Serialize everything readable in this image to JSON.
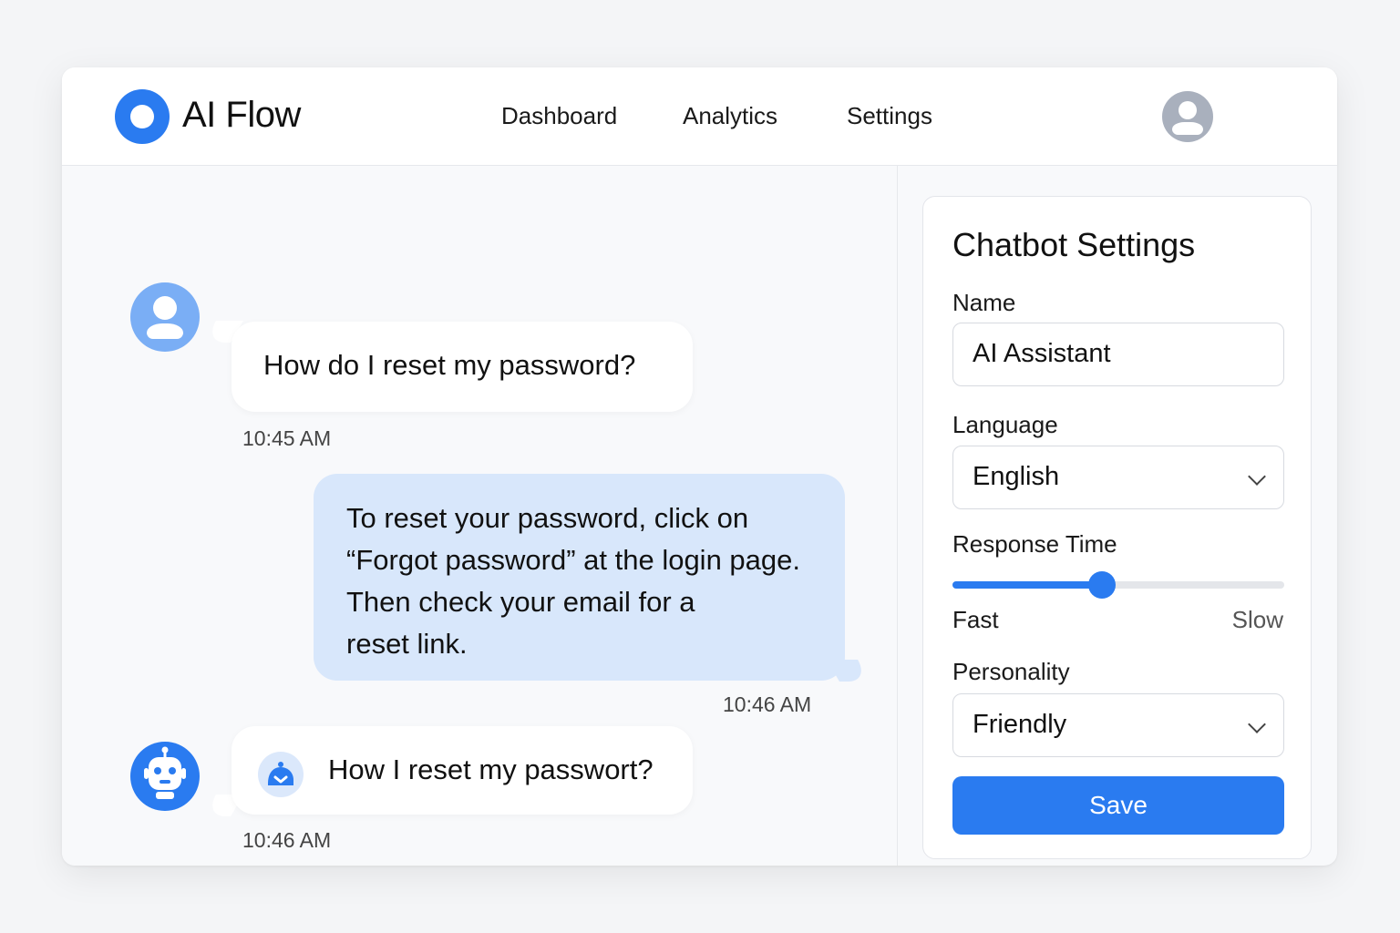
{
  "header": {
    "app_title": "AI Flow",
    "nav": [
      {
        "label": "Dashboard"
      },
      {
        "label": "Analytics"
      },
      {
        "label": "Settings"
      }
    ]
  },
  "chat": {
    "messages": [
      {
        "sender": "user",
        "text": "How do I reset my password?",
        "time": "10:45 AM"
      },
      {
        "sender": "assistant",
        "lines": [
          "To reset your password, click on",
          "“Forgot password” at the login page.",
          "Then check your email for a",
          "reset link."
        ],
        "time": "10:46 AM"
      },
      {
        "sender": "bot",
        "text": "How I reset my passwort?",
        "time": "10:46 AM"
      }
    ]
  },
  "settings": {
    "title": "Chatbot Settings",
    "name_label": "Name",
    "name_value": "AI Assistant",
    "language_label": "Language",
    "language_value": "English",
    "response_time_label": "Response Time",
    "response_time_min": "Fast",
    "response_time_max": "Slow",
    "response_time_fraction": 0.45,
    "personality_label": "Personality",
    "personality_value": "Friendly",
    "save_label": "Save"
  },
  "colors": {
    "accent": "#2a7bf0",
    "user_avatar": "#7aaef5",
    "assistant_bubble": "#d8e7fb"
  },
  "icons": {
    "logo": "ring-logo-icon",
    "profile": "user-icon",
    "bot": "robot-icon",
    "message_badge": "chat-bubble-icon"
  }
}
